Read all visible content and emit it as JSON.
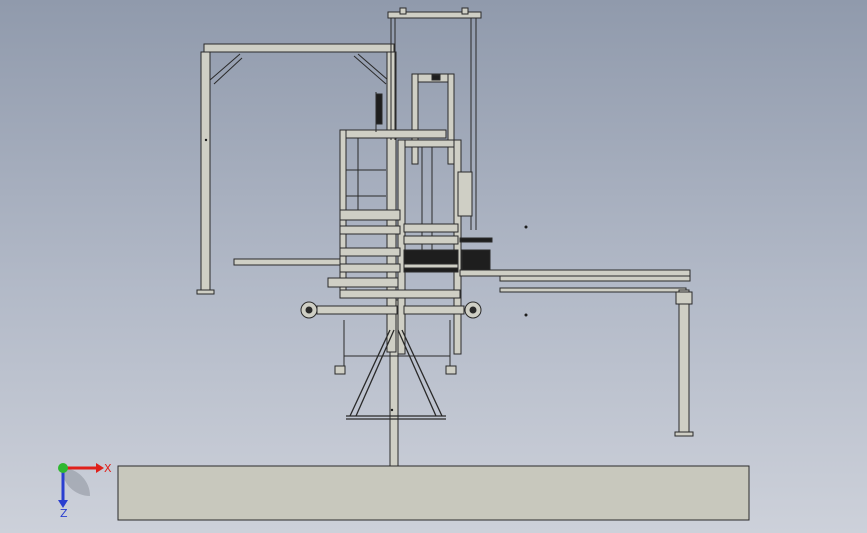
{
  "triad": {
    "x_label": "X",
    "z_label": "Z",
    "x_color": "#e0201a",
    "z_color": "#2a3fd0",
    "y_color": "#2fb82f"
  },
  "colors": {
    "background_top": "#909aac",
    "background_bottom": "#cdd1da",
    "machine_face": "#cfcfc5",
    "machine_edge": "#2a2a2a",
    "base_plate": "#c8c8bd",
    "dark_detail": "#1e1e1e"
  },
  "view": {
    "model_icon": "cad-assembly-icon",
    "triad_icon": "axis-triad-icon"
  }
}
